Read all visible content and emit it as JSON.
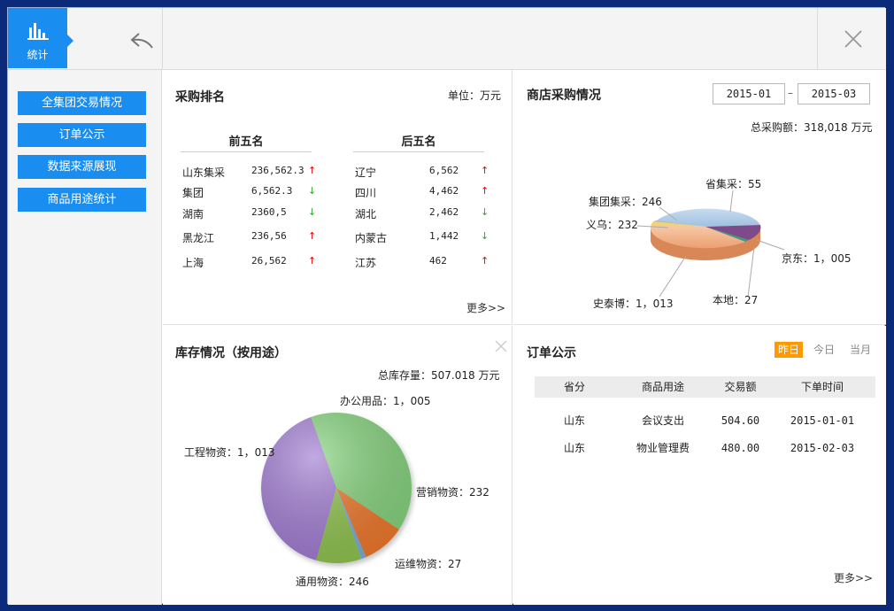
{
  "topbar": {
    "stat_tab_label": "统计",
    "icons": {
      "stat": "bar-chart-icon",
      "back": "back-arrow-icon",
      "close": "close-icon"
    }
  },
  "sidebar": {
    "items": [
      {
        "label": "全集团交易情况"
      },
      {
        "label": "订单公示"
      },
      {
        "label": "数据来源展现"
      },
      {
        "label": "商品用途统计"
      }
    ]
  },
  "purchase_rank": {
    "title": "采购排名",
    "unit": "单位：万元",
    "top_header": "前五名",
    "bottom_header": "后五名",
    "top_rows": [
      {
        "name": "山东集采",
        "value": "236,562.3",
        "trend": "up"
      },
      {
        "name": "集团",
        "value": "6,562.3",
        "trend": "down"
      },
      {
        "name": "湖南",
        "value": "2360,5",
        "trend": "down"
      },
      {
        "name": "黑龙江",
        "value": "236,56",
        "trend": "up"
      },
      {
        "name": "上海",
        "value": "26,562",
        "trend": "up"
      }
    ],
    "bottom_rows": [
      {
        "name": "辽宁",
        "value": "6,562",
        "trend": "up"
      },
      {
        "name": "四川",
        "value": "4,462",
        "trend": "up"
      },
      {
        "name": "湖北",
        "value": "2,462",
        "trend": "down"
      },
      {
        "name": "内蒙古",
        "value": "1,442",
        "trend": "down"
      },
      {
        "name": "江苏",
        "value": "462",
        "trend": "up"
      }
    ],
    "more": "更多>>"
  },
  "store_purchase": {
    "title": "商店采购情况",
    "date_from": "2015-01",
    "date_sep": "–",
    "date_to": "2015-03",
    "total": "总采购额：318,018  万元",
    "pie_labels": {
      "sheng": "省集采：55",
      "jituan": "集团集采：246",
      "yiwu": "义乌：232",
      "jingdong": "京东：1，005",
      "bendi": "本地：27",
      "shitaibo": "史泰博：1，013"
    }
  },
  "inventory": {
    "title": "库存情况（按用途）",
    "total": "总库存量：507.018  万元",
    "pie_labels": {
      "bangong": "办公用品：1，005",
      "gongcheng": "工程物资：1，013",
      "yingxiao": "营销物资：232",
      "yunwei": "运维物资：27",
      "tongyong": "通用物资：246"
    }
  },
  "orders": {
    "title": "订单公示",
    "tabs": [
      "昨日",
      "今日",
      "当月"
    ],
    "columns": [
      "省分",
      "商品用途",
      "交易额",
      "下单时间"
    ],
    "rows": [
      {
        "province": "山东",
        "usage": "会议支出",
        "amount": "504.60",
        "time": "2015-01-01"
      },
      {
        "province": "山东",
        "usage": "物业管理费",
        "amount": "480.00",
        "time": "2015-02-03"
      }
    ],
    "more": "更多>>"
  },
  "chart_data": [
    {
      "type": "pie",
      "title": "商店采购情况",
      "categories": [
        "省集采",
        "集团集采",
        "义乌",
        "京东",
        "本地",
        "史泰博"
      ],
      "values": [
        55,
        246,
        232,
        1005,
        27,
        1013
      ]
    },
    {
      "type": "pie",
      "title": "库存情况（按用途）",
      "categories": [
        "办公用品",
        "营销物资",
        "运维物资",
        "通用物资",
        "工程物资"
      ],
      "values": [
        1005,
        232,
        27,
        246,
        1013
      ]
    }
  ],
  "colors": {
    "accent": "#1a8ef0",
    "up": "#e60000",
    "down": "#2aa52a",
    "tab_active": "#ff9900"
  }
}
